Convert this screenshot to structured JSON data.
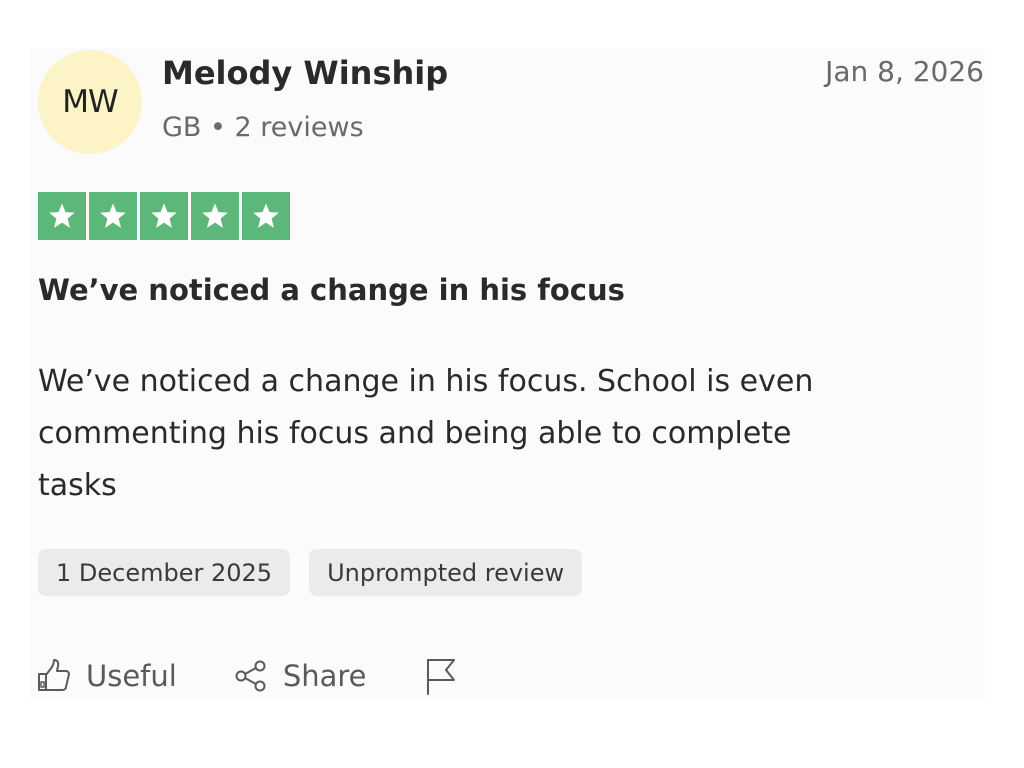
{
  "reviewer": {
    "initials": "MW",
    "name": "Melody Winship",
    "meta": "GB • 2 reviews",
    "avatar_color": "#fcf3c7"
  },
  "review": {
    "date": "Jan 8, 2026",
    "rating": 5,
    "rating_max": 5,
    "star_color": "#5cb87a",
    "title": "We’ve noticed a change in his focus",
    "body": "We’ve noticed a change in his focus. School is even commenting his focus and being able to complete tasks",
    "tags": [
      {
        "label": "1 December 2025",
        "icon": ""
      },
      {
        "label": "Unprompted review",
        "icon": ""
      }
    ]
  },
  "actions": {
    "useful": {
      "label": "Useful",
      "icon": "thumbs-up-icon"
    },
    "share": {
      "label": "Share",
      "icon": "share-icon"
    },
    "flag": {
      "icon": "flag-icon"
    }
  }
}
